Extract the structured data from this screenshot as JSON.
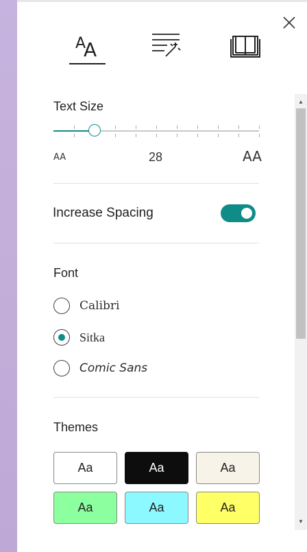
{
  "tabs": [
    {
      "name": "text-preferences",
      "icon": "text-size-icon",
      "active": true
    },
    {
      "name": "grammar-options",
      "icon": "grammar-sparkle-icon",
      "active": false
    },
    {
      "name": "reading-preferences",
      "icon": "open-book-icon",
      "active": false
    }
  ],
  "text_size": {
    "title": "Text Size",
    "value": "28",
    "level_fraction": 0.2,
    "small_glyph": "AA",
    "large_glyph": "AA"
  },
  "spacing": {
    "label": "Increase Spacing",
    "enabled": true
  },
  "font": {
    "title": "Font",
    "options": [
      {
        "label": "Calibri",
        "selected": false
      },
      {
        "label": "Sitka",
        "selected": true
      },
      {
        "label": "Comic Sans",
        "selected": false
      }
    ]
  },
  "themes": {
    "title": "Themes",
    "items": [
      {
        "label": "Aa",
        "background": "#ffffff",
        "text": "#222222"
      },
      {
        "label": "Aa",
        "background": "#0d0d0d",
        "text": "#ffffff"
      },
      {
        "label": "Aa",
        "background": "#f7f3e9",
        "text": "#222222"
      },
      {
        "label": "Aa",
        "background": "#8cff9e",
        "text": "#222222"
      },
      {
        "label": "Aa",
        "background": "#8bf9ff",
        "text": "#222222"
      },
      {
        "label": "Aa",
        "background": "#ffff66",
        "text": "#222222"
      }
    ]
  },
  "colors": {
    "accent": "#0f8c87",
    "side_strip": "#c5b0db"
  }
}
